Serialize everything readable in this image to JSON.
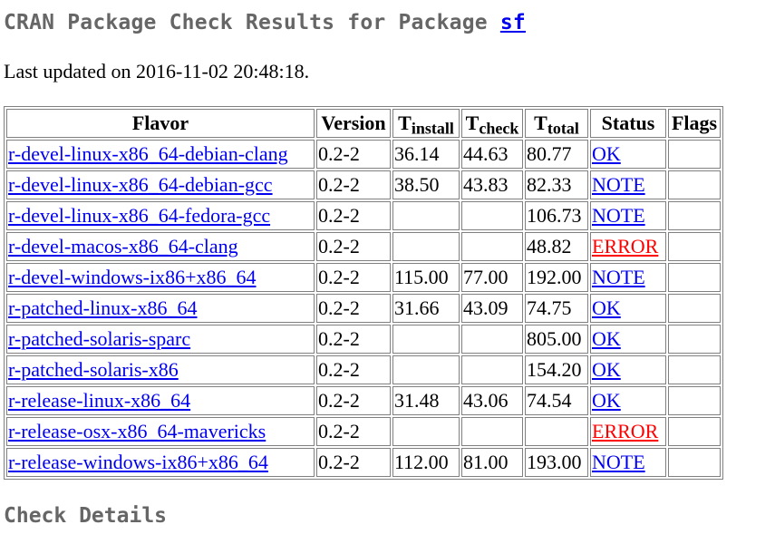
{
  "header": {
    "title_prefix": "CRAN Package Check Results for Package",
    "package_name": "sf"
  },
  "updated_text": "Last updated on 2016-11-02 20:48:18.",
  "table": {
    "headers": {
      "flavor": "Flavor",
      "version": "Version",
      "t_install_main": "T",
      "t_install_sub": "install",
      "t_check_main": "T",
      "t_check_sub": "check",
      "t_total_main": "T",
      "t_total_sub": "total",
      "status": "Status",
      "flags": "Flags"
    },
    "rows": [
      {
        "flavor": "r-devel-linux-x86_64-debian-clang",
        "version": "0.2-2",
        "t_install": "36.14",
        "t_check": "44.63",
        "t_total": "80.77",
        "status": "OK",
        "flags": ""
      },
      {
        "flavor": "r-devel-linux-x86_64-debian-gcc",
        "version": "0.2-2",
        "t_install": "38.50",
        "t_check": "43.83",
        "t_total": "82.33",
        "status": "NOTE",
        "flags": ""
      },
      {
        "flavor": "r-devel-linux-x86_64-fedora-gcc",
        "version": "0.2-2",
        "t_install": "",
        "t_check": "",
        "t_total": "106.73",
        "status": "NOTE",
        "flags": ""
      },
      {
        "flavor": "r-devel-macos-x86_64-clang",
        "version": "0.2-2",
        "t_install": "",
        "t_check": "",
        "t_total": "48.82",
        "status": "ERROR",
        "flags": ""
      },
      {
        "flavor": "r-devel-windows-ix86+x86_64",
        "version": "0.2-2",
        "t_install": "115.00",
        "t_check": "77.00",
        "t_total": "192.00",
        "status": "NOTE",
        "flags": ""
      },
      {
        "flavor": "r-patched-linux-x86_64",
        "version": "0.2-2",
        "t_install": "31.66",
        "t_check": "43.09",
        "t_total": "74.75",
        "status": "OK",
        "flags": ""
      },
      {
        "flavor": "r-patched-solaris-sparc",
        "version": "0.2-2",
        "t_install": "",
        "t_check": "",
        "t_total": "805.00",
        "status": "OK",
        "flags": ""
      },
      {
        "flavor": "r-patched-solaris-x86",
        "version": "0.2-2",
        "t_install": "",
        "t_check": "",
        "t_total": "154.20",
        "status": "OK",
        "flags": ""
      },
      {
        "flavor": "r-release-linux-x86_64",
        "version": "0.2-2",
        "t_install": "31.48",
        "t_check": "43.06",
        "t_total": "74.54",
        "status": "OK",
        "flags": ""
      },
      {
        "flavor": "r-release-osx-x86_64-mavericks",
        "version": "0.2-2",
        "t_install": "",
        "t_check": "",
        "t_total": "",
        "status": "ERROR",
        "flags": ""
      },
      {
        "flavor": "r-release-windows-ix86+x86_64",
        "version": "0.2-2",
        "t_install": "112.00",
        "t_check": "81.00",
        "t_total": "193.00",
        "status": "NOTE",
        "flags": ""
      }
    ]
  },
  "section_check_details": "Check Details",
  "colors": {
    "heading": "#666666",
    "link": "#0000ee",
    "error": "#ff0000",
    "border": "#808080"
  }
}
